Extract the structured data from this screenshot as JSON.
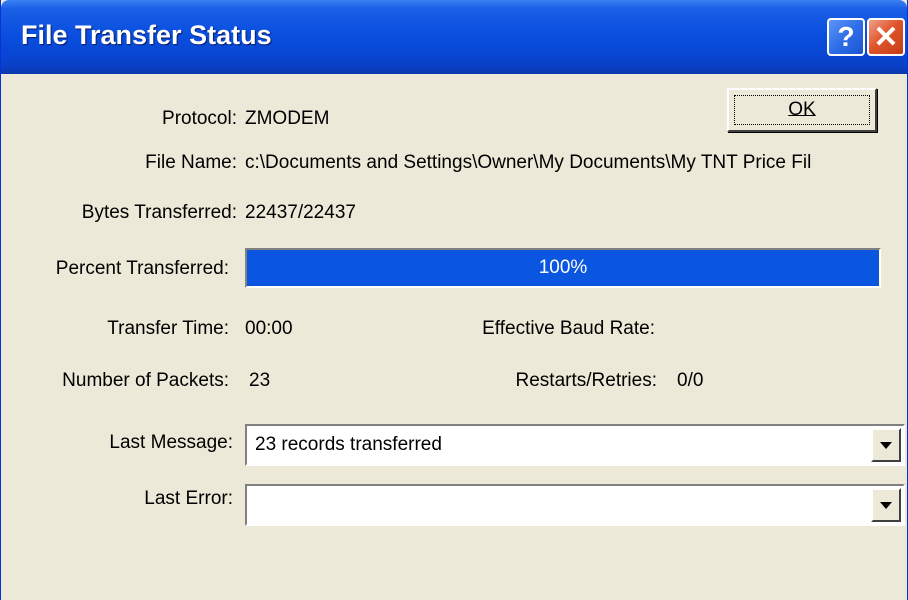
{
  "window": {
    "title": "File Transfer Status",
    "help_label": "?",
    "close_label": "✕"
  },
  "buttons": {
    "ok_label": "OK"
  },
  "fields": {
    "protocol": {
      "label": "Protocol:",
      "value": "ZMODEM"
    },
    "file_name": {
      "label": "File Name:",
      "value": "c:\\Documents and Settings\\Owner\\My Documents\\My TNT Price Fil"
    },
    "bytes_transferred": {
      "label": "Bytes Transferred:",
      "value": "22437/22437"
    },
    "percent_transferred": {
      "label": "Percent Transferred:",
      "value": "100%",
      "fraction": 1.0
    },
    "transfer_time": {
      "label": "Transfer Time:",
      "value": "00:00"
    },
    "effective_baud_rate": {
      "label": "Effective Baud Rate:",
      "value": ""
    },
    "number_of_packets": {
      "label": "Number of Packets:",
      "value": "23"
    },
    "restarts_retries": {
      "label": "Restarts/Retries:",
      "value": "0/0"
    },
    "last_message": {
      "label": "Last Message:",
      "value": "23 records transferred"
    },
    "last_error": {
      "label": "Last Error:",
      "value": ""
    }
  },
  "colors": {
    "title_bar": "#0a4fdf",
    "progress_fill": "#0a56e0",
    "dialog_background": "#ece9d8"
  },
  "icons": {
    "help": "question-mark-icon",
    "close": "close-x-icon",
    "dropdown": "chevron-down-icon"
  }
}
